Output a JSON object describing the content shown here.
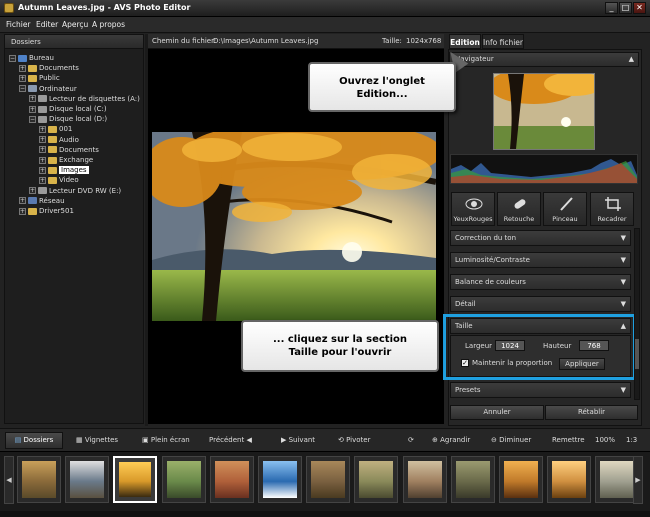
{
  "window": {
    "title": "Autumn Leaves.jpg - AVS Photo Editor",
    "controls": [
      "_",
      "□",
      "✕"
    ]
  },
  "menu": [
    "Fichier",
    "Editer",
    "Aperçu",
    "A propos"
  ],
  "folders": {
    "header": "Dossiers",
    "items": [
      {
        "label": "Bureau",
        "expander": "−",
        "icon": "desktop-icon",
        "color": "#4f82c8"
      },
      {
        "label": "Documents",
        "expander": "+",
        "icon": "folder-icon",
        "color": "#d8b34a"
      },
      {
        "label": "Public",
        "expander": "+",
        "icon": "folder-icon",
        "color": "#d8b34a"
      },
      {
        "label": "Ordinateur",
        "expander": "−",
        "icon": "computer-icon",
        "color": "#8a9ab0"
      },
      {
        "label": "Lecteur de disquettes (A:)",
        "expander": "+",
        "icon": "floppy-icon",
        "color": "#9a9a9a"
      },
      {
        "label": "Disque local (C:)",
        "expander": "+",
        "icon": "drive-icon",
        "color": "#9a9a9a"
      },
      {
        "label": "Disque local (D:)",
        "expander": "−",
        "icon": "drive-icon",
        "color": "#9a9a9a"
      },
      {
        "label": "001",
        "expander": "+",
        "icon": "folder-icon",
        "color": "#d8b34a"
      },
      {
        "label": "Audio",
        "expander": "+",
        "icon": "folder-icon",
        "color": "#d8b34a"
      },
      {
        "label": "Documents",
        "expander": "+",
        "icon": "folder-icon",
        "color": "#d8b34a"
      },
      {
        "label": "Exchange",
        "expander": "+",
        "icon": "folder-icon",
        "color": "#d8b34a"
      },
      {
        "label": "Images",
        "expander": "+",
        "icon": "folder-icon",
        "color": "#d8b34a",
        "selected": true
      },
      {
        "label": "Video",
        "expander": "+",
        "icon": "folder-icon",
        "color": "#d8b34a"
      },
      {
        "label": "Lecteur DVD RW (E:)",
        "expander": "+",
        "icon": "dvd-icon",
        "color": "#9a9a9a"
      },
      {
        "label": "Réseau",
        "expander": "+",
        "icon": "network-icon",
        "color": "#5a7ab0"
      },
      {
        "label": "Driver501",
        "expander": "+",
        "icon": "folder-icon",
        "color": "#d8b34a"
      }
    ]
  },
  "filepath": {
    "label": "Chemin du fichier:",
    "value": "D:\\Images\\Autumn Leaves.jpg",
    "size_label": "Taille:",
    "size_value": "1024x768"
  },
  "tabs": [
    "Edition",
    "Info fichier"
  ],
  "navigator": {
    "label": "Navigateur"
  },
  "tools": [
    {
      "label": "YeuxRouges",
      "icon": "eye-icon"
    },
    {
      "label": "Retouche",
      "icon": "bandage-icon"
    },
    {
      "label": "Pinceau",
      "icon": "brush-icon"
    },
    {
      "label": "Recadrer",
      "icon": "crop-icon"
    }
  ],
  "sections": [
    "Correction du ton",
    "Luminosité/Contraste",
    "Balance de couleurs",
    "Détail"
  ],
  "taille": {
    "title": "Taille",
    "width_label": "Largeur",
    "width_value": "1024",
    "height_label": "Hauteur",
    "height_value": "768",
    "keep_label": "Maintenir la proportion",
    "apply_label": "Appliquer"
  },
  "presets_label": "Presets",
  "bottom_buttons": {
    "cancel": "Annuler",
    "reset": "Rétablir"
  },
  "callouts": {
    "top": "Ouvrez l'onglet\nEdition...",
    "bottom": "... cliquez sur la section\nTaille pour l'ouvrir"
  },
  "toolbar": {
    "folders": "Dossiers",
    "thumbnails": "Vignettes",
    "fullscreen": "Plein écran",
    "prev": "Précédent",
    "next": "Suivant",
    "rotate": "Pivoter",
    "enlarge": "Agrandir",
    "reduce": "Diminuer",
    "fit": "Remettre",
    "zoom": "100%",
    "ratio": "1:3"
  },
  "colors": {
    "accent": "#1fa0e0",
    "bg": "#222222"
  },
  "thumbnails": [
    {
      "colors": [
        "#8a6a3a",
        "#c9a05a",
        "#5a4a2a"
      ]
    },
    {
      "colors": [
        "#6a7a8a",
        "#e0e0e0",
        "#5a5040"
      ]
    },
    {
      "colors": [
        "#d99a2a",
        "#ffcc55",
        "#3a2a10"
      ],
      "selected": true
    },
    {
      "colors": [
        "#6a8a4a",
        "#9ab06a",
        "#3a4a2a"
      ]
    },
    {
      "colors": [
        "#b0603a",
        "#d0905a",
        "#6a3020"
      ]
    },
    {
      "colors": [
        "#2a6ab0",
        "#8ac0f0",
        "#ffffff"
      ]
    },
    {
      "colors": [
        "#7a6040",
        "#a8885a",
        "#4a3a20"
      ]
    },
    {
      "colors": [
        "#8a8a5a",
        "#c0b080",
        "#4a4a30"
      ]
    },
    {
      "colors": [
        "#a08060",
        "#d0c0a0",
        "#504030"
      ]
    },
    {
      "colors": [
        "#6a6a4a",
        "#9a9a70",
        "#3a3a2a"
      ]
    },
    {
      "colors": [
        "#c07a2a",
        "#f0b050",
        "#5a3010"
      ]
    },
    {
      "colors": [
        "#d09040",
        "#ffd080",
        "#6a4010"
      ]
    },
    {
      "colors": [
        "#a0a090",
        "#e0d8c0",
        "#606050"
      ]
    }
  ]
}
